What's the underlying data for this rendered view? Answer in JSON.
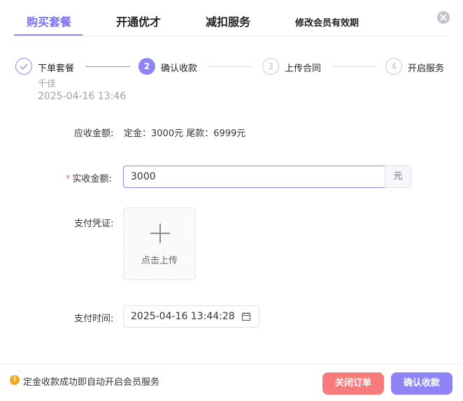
{
  "tabs": [
    {
      "label": "购买套餐",
      "active": true
    },
    {
      "label": "开通优才",
      "active": false
    },
    {
      "label": "减扣服务",
      "active": false
    },
    {
      "label": "修改会员有效期",
      "active": false
    }
  ],
  "steps": [
    {
      "number": "✓",
      "title": "下单套餐",
      "status": "done",
      "desc_name": "千佳",
      "desc_time": "2025-04-16 13:46"
    },
    {
      "number": "2",
      "title": "确认收款",
      "status": "active"
    },
    {
      "number": "3",
      "title": "上传合同",
      "status": "pending"
    },
    {
      "number": "4",
      "title": "开启服务",
      "status": "pending"
    }
  ],
  "form": {
    "receivable_label": "应收金额:",
    "receivable_value": "定金：3000元 尾款：6999元",
    "actual_required": "*",
    "actual_label": "实收金额:",
    "actual_value": "3000",
    "actual_unit": "元",
    "voucher_label": "支付凭证:",
    "upload_text": "点击上传",
    "pay_time_label": "支付时间:",
    "pay_time_value": "2025-04-16 13:44:28"
  },
  "footer": {
    "notice": "定金收款成功即自动开启会员服务",
    "close_order_label": "关闭订单",
    "confirm_label": "确认收款"
  },
  "colors": {
    "accent": "#8f84f7",
    "danger": "#f77b7b",
    "warning": "#f5a623"
  }
}
